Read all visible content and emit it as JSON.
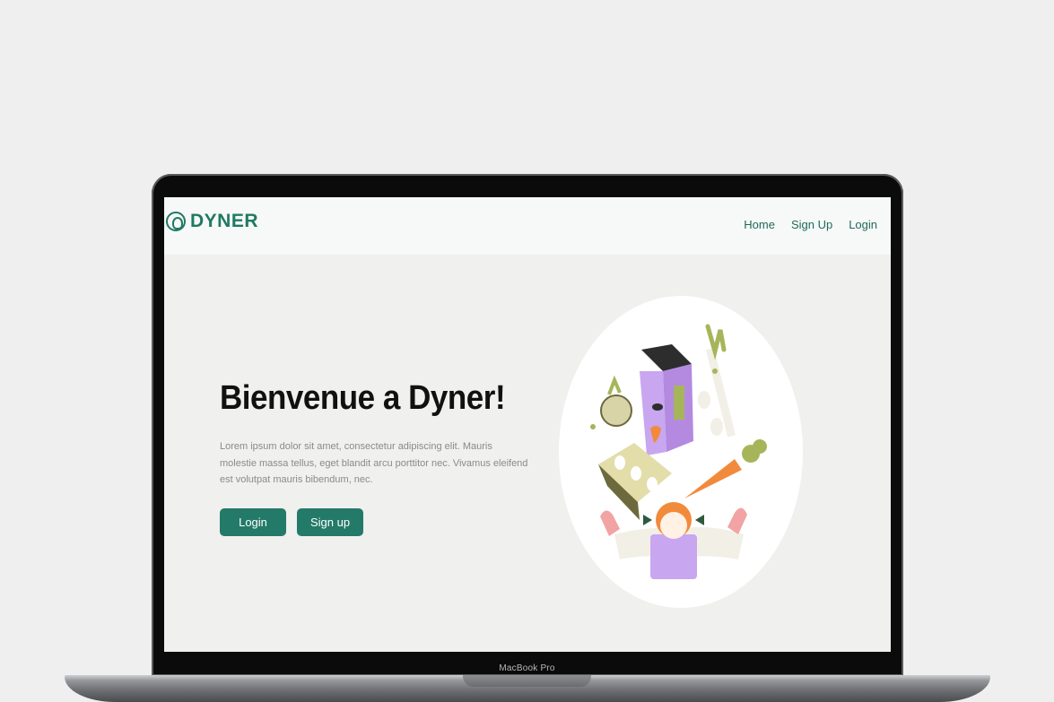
{
  "device": {
    "label": "MacBook Pro"
  },
  "nav": {
    "brand": "DYNER",
    "links": [
      "Home",
      "Sign Up",
      "Login"
    ]
  },
  "hero": {
    "title": "Bienvenue a Dyner!",
    "body": "Lorem ipsum dolor sit amet, consectetur adipiscing elit. Mauris molestie massa tellus, eget blandit arcu porttitor nec. Vivamus eleifend est volutpat mauris bibendum, nec.",
    "login_label": "Login",
    "signup_label": "Sign up"
  },
  "colors": {
    "brand": "#1f7a62",
    "button": "#247a68",
    "background": "#f0f0ee"
  },
  "icons": {
    "brand_logo": "dyner-logo-icon",
    "illustration": "food-illustration"
  }
}
